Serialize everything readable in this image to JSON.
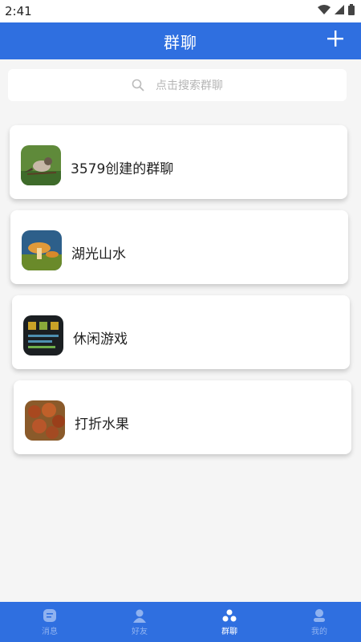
{
  "status_bar": {
    "time": "2:41"
  },
  "header": {
    "title": "群聊",
    "add_icon": "plus-icon"
  },
  "search": {
    "placeholder": "点击搜索群聊",
    "icon": "search-icon"
  },
  "groups": [
    {
      "name": "3579创建的群聊",
      "avatar": "bird-photo"
    },
    {
      "name": "湖光山水",
      "avatar": "mushroom-photo"
    },
    {
      "name": "休闲游戏",
      "avatar": "game-screen-photo"
    },
    {
      "name": "打折水果",
      "avatar": "fruit-photo"
    }
  ],
  "bottom_nav": [
    {
      "label": "消息",
      "icon": "message-icon",
      "active": false
    },
    {
      "label": "好友",
      "icon": "friends-icon",
      "active": false
    },
    {
      "label": "群聊",
      "icon": "group-icon",
      "active": true
    },
    {
      "label": "我的",
      "icon": "profile-icon",
      "active": false
    }
  ],
  "colors": {
    "primary": "#2f6fe0",
    "background": "#f5f5f5",
    "inactive_nav": "#8fb2f0"
  }
}
